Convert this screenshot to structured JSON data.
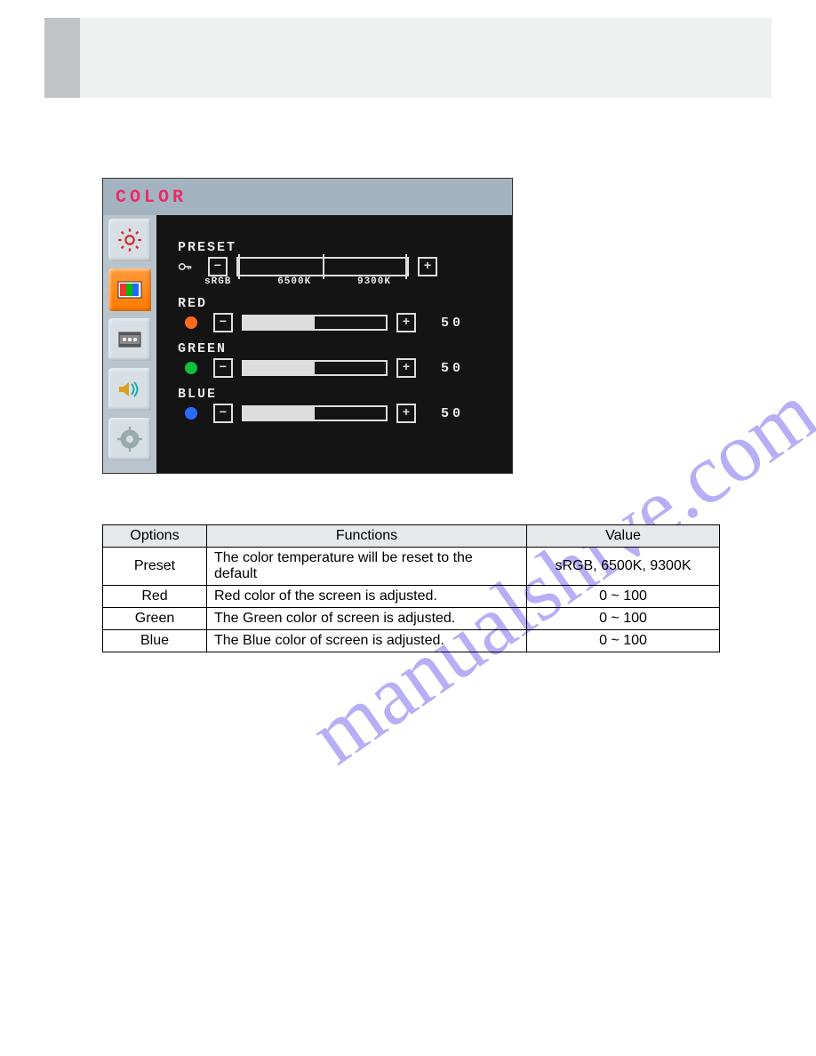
{
  "watermark": "manualshive.com",
  "osd": {
    "title": "COLOR",
    "sidebar": [
      {
        "name": "brightness-icon",
        "active": false
      },
      {
        "name": "color-icon",
        "active": true
      },
      {
        "name": "image-setup-icon",
        "active": false
      },
      {
        "name": "audio-icon",
        "active": false
      },
      {
        "name": "settings-icon",
        "active": false
      }
    ],
    "rows": {
      "preset": {
        "label": "PRESET",
        "options": [
          "sRGB",
          "6500K",
          "9300K"
        ]
      },
      "red": {
        "label": "RED",
        "value": "50",
        "color": "#ff6a1a"
      },
      "green": {
        "label": "GREEN",
        "value": "50",
        "color": "#0bbf3f"
      },
      "blue": {
        "label": "BLUE",
        "value": "50",
        "color": "#2a6bff"
      }
    },
    "button_minus": "−",
    "button_plus": "+"
  },
  "table": {
    "headers": {
      "options": "Options",
      "functions": "Functions",
      "value": "Value"
    },
    "rows": [
      {
        "option": "Preset",
        "func": "The color temperature will be reset to the default",
        "value": "sRGB, 6500K, 9300K"
      },
      {
        "option": "Red",
        "func": "Red color of the screen is adjusted.",
        "value": "0 ~ 100"
      },
      {
        "option": "Green",
        "func": "The Green color of screen is adjusted.",
        "value": "0 ~ 100"
      },
      {
        "option": "Blue",
        "func": "The Blue color of screen is adjusted.",
        "value": "0 ~ 100"
      }
    ]
  }
}
